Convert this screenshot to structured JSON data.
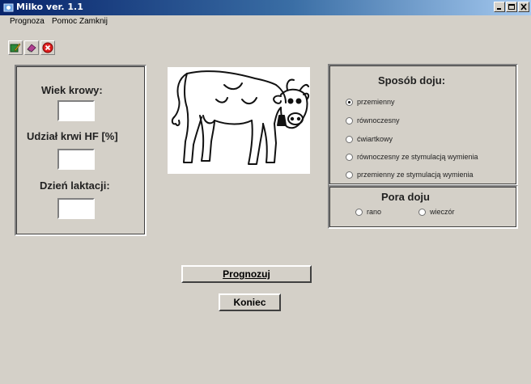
{
  "window": {
    "title": "Milko ver. 1.1",
    "controls": [
      "minimize",
      "maximize",
      "close"
    ]
  },
  "menu": {
    "items": [
      "Prognoza",
      "Pomoc",
      "Zamknij"
    ]
  },
  "toolbar": {
    "icons": [
      "book-pencil-icon",
      "eraser-icon",
      "stop-icon"
    ]
  },
  "inputs": {
    "wiek_label": "Wiek krowy:",
    "wiek_value": "",
    "krew_label": "Udział krwi HF [%]",
    "krew_value": "",
    "dzien_label": "Dzień laktacji:",
    "dzien_value": ""
  },
  "image": {
    "subject": "cow line drawing"
  },
  "milking_method": {
    "title": "Sposób doju:",
    "options": [
      {
        "label": "przemienny",
        "selected": true
      },
      {
        "label": "równoczesny",
        "selected": false
      },
      {
        "label": "ćwiartkowy",
        "selected": false
      },
      {
        "label": "równoczesny ze stymulacją wymienia",
        "selected": false
      },
      {
        "label": "przemienny ze stymulacją wymienia",
        "selected": false
      }
    ]
  },
  "milking_time": {
    "title": "Pora doju",
    "options": [
      {
        "label": "rano",
        "selected": false
      },
      {
        "label": "wieczór",
        "selected": false
      }
    ]
  },
  "buttons": {
    "predict": "Prognozuj",
    "end": "Koniec"
  }
}
